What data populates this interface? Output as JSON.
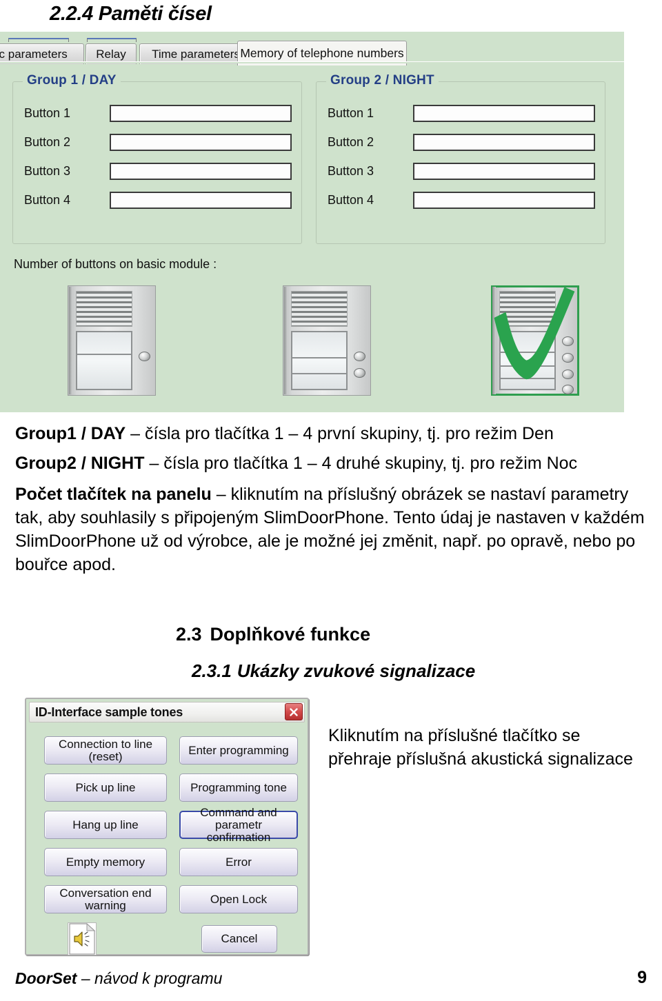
{
  "document": {
    "title": "2.2.4 Paměti čísel",
    "footer_text_bold": "DoorSet",
    "footer_text_rest": " – návod k programu",
    "page_number": "9"
  },
  "screenshot": {
    "tabs": [
      {
        "label": "sic parameters",
        "active": false
      },
      {
        "label": "Relay",
        "active": false
      },
      {
        "label": "Time parameters",
        "active": false
      },
      {
        "label": "Memory of telephone numbers",
        "active": true
      }
    ],
    "group_day": {
      "title": "Group 1 / DAY",
      "rows": [
        {
          "label": "Button 1",
          "value": ""
        },
        {
          "label": "Button 2",
          "value": ""
        },
        {
          "label": "Button 3",
          "value": ""
        },
        {
          "label": "Button 4",
          "value": ""
        }
      ]
    },
    "group_night": {
      "title": "Group 2 / NIGHT",
      "rows": [
        {
          "label": "Button 1",
          "value": ""
        },
        {
          "label": "Button 2",
          "value": ""
        },
        {
          "label": "Button 3",
          "value": ""
        },
        {
          "label": "Button 4",
          "value": ""
        }
      ]
    },
    "buttons_count_label": "Number of buttons on basic module :",
    "panel_images": [
      {
        "name": "one-button-panel",
        "buttons": 1,
        "selected": false
      },
      {
        "name": "two-button-panel",
        "buttons": 2,
        "selected": false
      },
      {
        "name": "four-button-panel",
        "buttons": 4,
        "selected": true
      }
    ],
    "accent_color": "#243f86",
    "background_color": "#cfe2cc",
    "selection_color": "#2f9e4f"
  },
  "body": {
    "group1_bold": "Group1 / DAY",
    "group1_rest": " – čísla pro tlačítka 1 – 4 první skupiny, tj. pro režim Den",
    "group2_bold": "Group2 / NIGHT",
    "group2_rest": " – čísla pro tlačítka 1 – 4 druhé skupiny, tj. pro režim Noc",
    "count_bold": "Počet tlačítek na panelu",
    "count_rest": " – kliknutím na příslušný obrázek se nastaví parametry tak, aby souhlasily s připojeným SlimDoorPhone. Tento údaj je nastaven v každém SlimDoorPhone už od výrobce, ale je možné jej změnit, např. po opravě, nebo po bouřce apod."
  },
  "headings": {
    "h2_number": "2.3",
    "h2_text": "Doplňkové funkce",
    "h3_number": "2.3.1",
    "h3_text": "Ukázky zvukové signalizace"
  },
  "dialog": {
    "title": "ID-Interface sample tones",
    "close_glyph": "✕",
    "buttons_left": [
      "Connection to line (reset)",
      "Pick up line",
      "Hang up line",
      "Empty memory",
      "Conversation end warning"
    ],
    "buttons_right": [
      "Enter programming",
      "Programming tone",
      "Command and parametr\nconfirmation",
      "Error",
      "Open Lock"
    ],
    "focused_button": "Command and parametr confirmation",
    "cancel_label": "Cancel",
    "sound_icon_name": "sound-file-icon"
  },
  "caption": {
    "line1": "Kliknutím na příslušné tlačítko se",
    "line2": "přehraje příslušná akustická signalizace"
  }
}
